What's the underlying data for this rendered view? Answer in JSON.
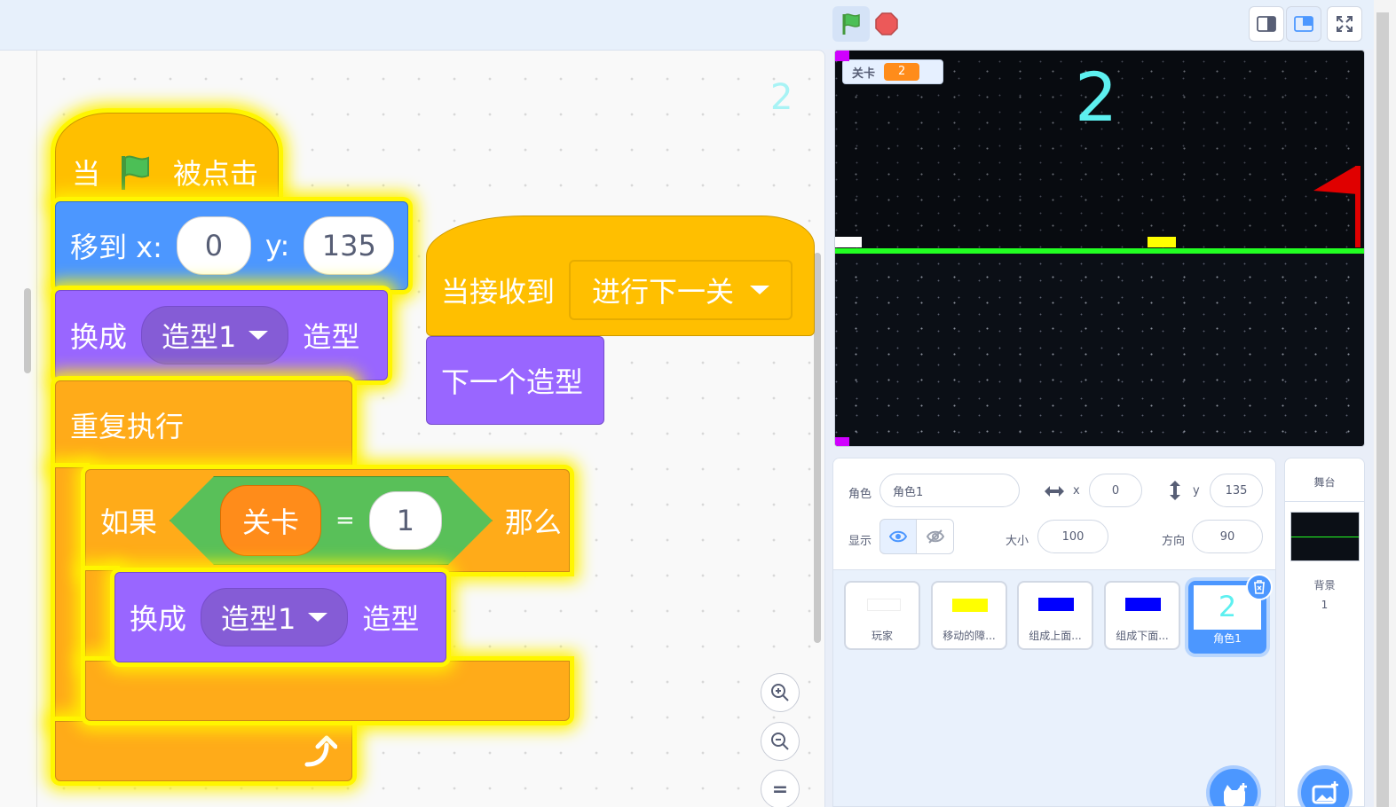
{
  "workspace": {
    "corner_value": "2",
    "hat_flag": {
      "prefix": "当",
      "suffix": "被点击"
    },
    "goto": {
      "label": "移到 x:",
      "x_value": "0",
      "y_label": "y:",
      "y_value": "135"
    },
    "costume1": {
      "label": "换成",
      "costume": "造型1",
      "suffix": "造型"
    },
    "forever": {
      "label": "重复执行"
    },
    "if_block": {
      "label": "如果",
      "variable": "关卡",
      "operator": "=",
      "compare_value": "1",
      "then_label": "那么"
    },
    "costume2": {
      "label": "换成",
      "costume": "造型1",
      "suffix": "造型"
    },
    "hat_receive": {
      "label": "当接收到",
      "message": "进行下一关"
    },
    "next_costume": {
      "label": "下一个造型"
    },
    "zoom_reset": "="
  },
  "stage": {
    "var_monitor": {
      "name": "关卡",
      "value": "2"
    },
    "level_number": "2"
  },
  "sprite_info": {
    "sprite_label": "角色",
    "sprite_name": "角色1",
    "x_label": "x",
    "x_value": "0",
    "y_label": "y",
    "y_value": "135",
    "show_label": "显示",
    "size_label": "大小",
    "size_value": "100",
    "direction_label": "方向",
    "direction_value": "90"
  },
  "sprites": [
    {
      "name": "玩家",
      "color": "#ffffff"
    },
    {
      "name": "移动的障...",
      "color": "#ffff00"
    },
    {
      "name": "组成上面...",
      "color": "#0000ff"
    },
    {
      "name": "组成下面...",
      "color": "#0000ff"
    },
    {
      "name": "角色1",
      "glyph": "2"
    }
  ],
  "stage_panel": {
    "title": "舞台",
    "backdrop_label": "背景",
    "backdrop_count": "1"
  },
  "colors": {
    "events": "#ffbf00",
    "control": "#ffab19",
    "motion": "#4c97ff",
    "looks": "#9966ff",
    "operators": "#59c059",
    "variables": "#ff8c1a",
    "accent": "#4c97ff"
  }
}
